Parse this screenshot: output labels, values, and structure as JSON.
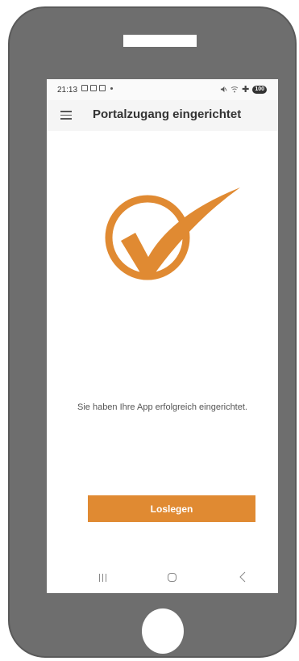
{
  "status_bar": {
    "time": "21:13",
    "left_icons": [
      "screenshot-icon",
      "gallery-icon",
      "mail-icon"
    ],
    "right_icons": [
      "mute-icon",
      "wifi-icon",
      "plus-icon"
    ],
    "battery": "100"
  },
  "app_bar": {
    "menu_icon": "hamburger-menu-icon",
    "title": "Portalzugang eingerichtet"
  },
  "main": {
    "success_icon": "checkmark-circle-icon",
    "message": "Sie haben Ihre App erfolgreich eingerichtet.",
    "button_label": "Loslegen"
  },
  "nav_bar": {
    "items": [
      "recents-icon",
      "home-icon",
      "back-icon"
    ]
  },
  "colors": {
    "accent": "#e08a32",
    "device_frame": "#6e6e6e",
    "title_text": "#333333"
  }
}
